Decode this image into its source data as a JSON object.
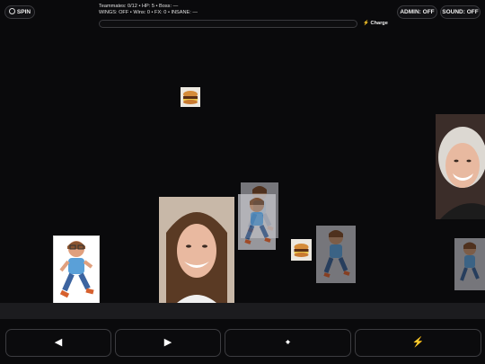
{
  "hud": {
    "spin_label": "SPIN",
    "stats_line1": "Teammates: 0/12 • HP: 5 • Boss: —",
    "stats_line2": "WINGS: OFF • Wins: 0 • FX: 0 • INSANE: —",
    "charge_label": "Charge",
    "charge_level": 0,
    "admin_label": "ADMIN: OFF",
    "sound_label": "SOUND: OFF"
  },
  "controls": {
    "left": "◀",
    "right": "▶",
    "jump": "🠹",
    "charge": "⚡"
  },
  "colors": {
    "background": "#0a0a0c",
    "accent": "#f5c400",
    "floor": "#1c1c1f"
  },
  "sprites": [
    {
      "type": "cartoon-runner",
      "role": "player"
    },
    {
      "type": "face-photo",
      "role": "teammate"
    },
    {
      "type": "cartoon-runner",
      "role": "enemy-ghost"
    },
    {
      "type": "cartoon-runner",
      "role": "enemy-ghost"
    },
    {
      "type": "cartoon-runner",
      "role": "enemy-ghost"
    },
    {
      "type": "burger",
      "role": "pickup"
    },
    {
      "type": "burger",
      "role": "pickup"
    },
    {
      "type": "face-photo",
      "role": "teammate"
    },
    {
      "type": "cartoon-runner",
      "role": "enemy-ghost"
    }
  ]
}
